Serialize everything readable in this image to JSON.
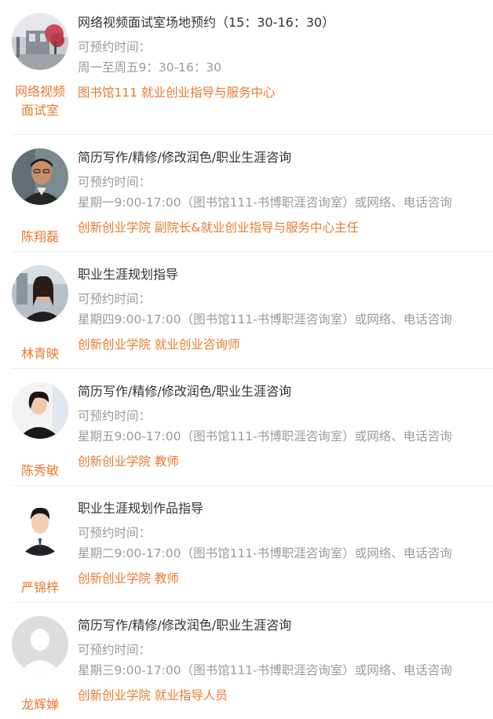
{
  "consultants": [
    {
      "name": "网络视频\n面试室",
      "title": "网络视频面试室场地预约（15：30-16：30）",
      "available_label": "可预约时间：",
      "time": "周一至周五9：30-16：30",
      "dept": "图书馆111 就业创业指导与服务中心",
      "avatar_icon": "building-photo-avatar"
    },
    {
      "name": "陈翔磊",
      "title": "简历写作/精修/修改润色/职业生涯咨询",
      "available_label": "可预约时间：",
      "time": "星期一9:00-17:00（图书馆111-书博职涯咨询室）或网络、电话咨询",
      "dept": "创新创业学院 副院长&就业创业指导与服务中心主任",
      "avatar_icon": "man-photo-avatar"
    },
    {
      "name": "林青映",
      "title": "职业生涯规划指导",
      "available_label": "可预约时间：",
      "time": "星期四9:00-17:00（图书馆111-书博职涯咨询室）或网络、电话咨询",
      "dept": "创新创业学院 就业创业咨询师",
      "avatar_icon": "woman-photo-avatar"
    },
    {
      "name": "陈秀敏",
      "title": "简历写作/精修/修改润色/职业生涯咨询",
      "available_label": "可预约时间：",
      "time": "星期五9:00-17:00（图书馆111-书博职涯咨询室）或网络、电话咨询",
      "dept": "创新创业学院 教师",
      "avatar_icon": "woman-photo-avatar"
    },
    {
      "name": "严锦梓",
      "title": "职业生涯规划作品指导",
      "available_label": "可预约时间：",
      "time": "星期二9:00-17:00（图书馆111-书博职涯咨询室）或网络、电话咨询",
      "dept": "创新创业学院 教师",
      "avatar_icon": "man-photo-avatar"
    },
    {
      "name": "龙辉婵",
      "title": "简历写作/精修/修改润色/职业生涯咨询",
      "available_label": "可预约时间：",
      "time": "星期三9:00-17:00（图书馆111-书博职涯咨询室）或网络、电话咨询",
      "dept": "创新创业学院 就业指导人员",
      "avatar_icon": "default-user-avatar"
    }
  ],
  "colors": {
    "accent": "#e87a2f",
    "title": "#333333",
    "muted": "#9a9a9a"
  }
}
